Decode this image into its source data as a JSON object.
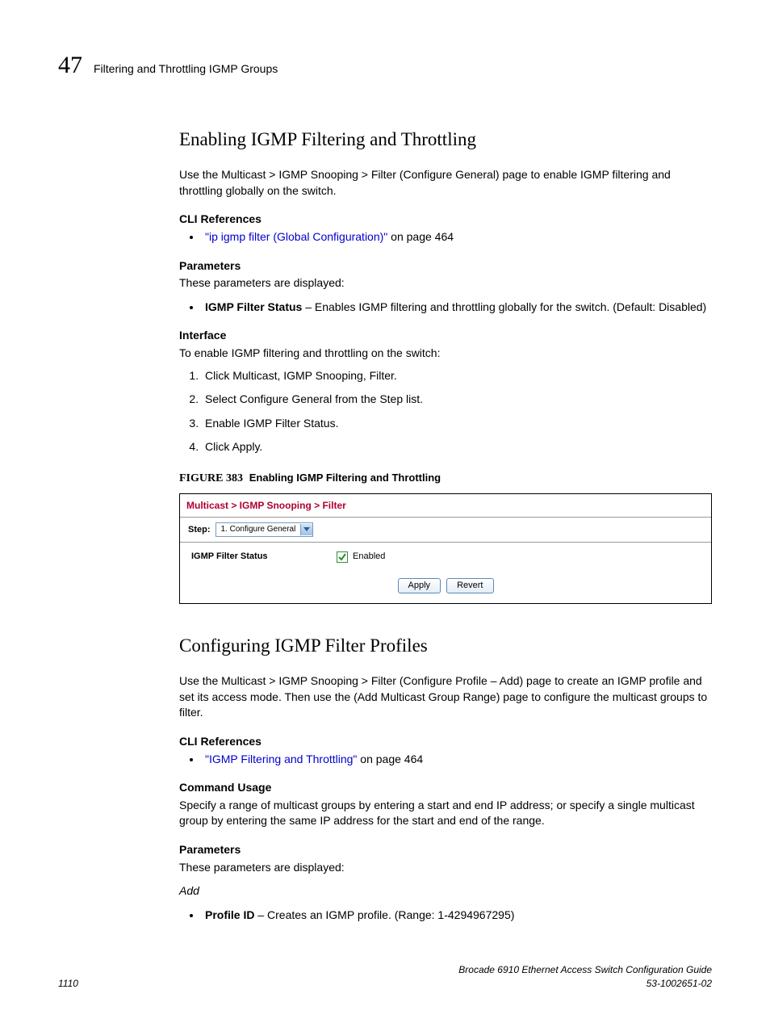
{
  "header": {
    "chapter_number": "47",
    "title": "Filtering and Throttling IGMP Groups"
  },
  "section1": {
    "heading": "Enabling IGMP Filtering and Throttling",
    "intro": "Use the Multicast > IGMP Snooping > Filter (Configure General) page to enable IGMP filtering and throttling globally on the switch.",
    "cli_ref_label": "CLI References",
    "cli_ref_link": "\"ip igmp filter (Global Configuration)\"",
    "cli_ref_suffix": " on page 464",
    "params_label": "Parameters",
    "params_intro": "These parameters are displayed:",
    "param1_name": "IGMP Filter Status",
    "param1_desc": " – Enables IGMP filtering and throttling globally for the switch. (Default: Disabled)",
    "interface_label": "Interface",
    "interface_intro": "To enable IGMP filtering and throttling on the switch:",
    "steps": [
      "Click Multicast, IGMP Snooping, Filter.",
      "Select Configure General from the Step list.",
      "Enable IGMP Filter Status.",
      "Click Apply."
    ],
    "figure_label": "FIGURE 383",
    "figure_title": "Enabling IGMP Filtering and Throttling"
  },
  "ui": {
    "breadcrumb": "Multicast > IGMP Snooping > Filter",
    "step_label": "Step:",
    "step_value": "1. Configure General",
    "row_label": "IGMP Filter Status",
    "checkbox_label": "Enabled",
    "apply": "Apply",
    "revert": "Revert"
  },
  "section2": {
    "heading": "Configuring IGMP Filter Profiles",
    "intro": "Use the Multicast > IGMP Snooping > Filter (Configure Profile – Add) page to create an IGMP profile and set its access mode. Then use the (Add Multicast Group Range) page to configure the multicast groups to filter.",
    "cli_ref_label": "CLI References",
    "cli_ref_link": "\"IGMP Filtering and Throttling\"",
    "cli_ref_suffix": " on page 464",
    "cmd_label": "Command Usage",
    "cmd_text": "Specify a range of multicast groups by entering a start and end IP address; or specify a single multicast group by entering the same IP address for the start and end of the range.",
    "params_label": "Parameters",
    "params_intro": "These parameters are displayed:",
    "add_label": "Add",
    "param1_name": "Profile ID",
    "param1_desc": " – Creates an IGMP profile. (Range: 1-4294967295)"
  },
  "footer": {
    "page": "1110",
    "doc_title": "Brocade 6910 Ethernet Access Switch Configuration Guide",
    "doc_num": "53-1002651-02"
  }
}
